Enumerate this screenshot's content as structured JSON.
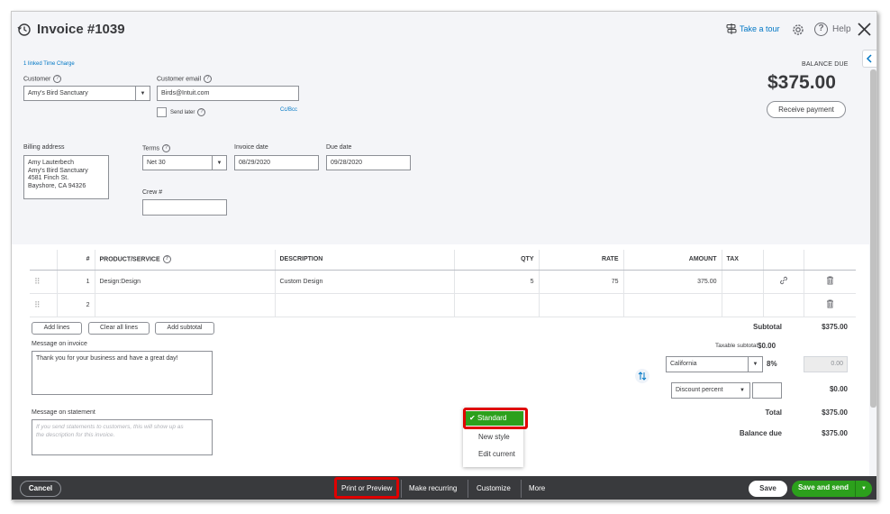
{
  "header": {
    "title": "Invoice #1039",
    "take_tour": "Take a tour",
    "help": "Help"
  },
  "form": {
    "linked_time": "1 linked Time Charge",
    "customer_label": "Customer",
    "customer_value": "Amy's Bird Sanctuary",
    "email_label": "Customer email",
    "email_value": "Birds@Intuit.com",
    "send_later": "Send later",
    "cc_bcc": "Cc/Bcc",
    "balance_label": "BALANCE DUE",
    "balance_amount": "$375.00",
    "receive_payment": "Receive payment",
    "billing_label": "Billing address",
    "billing_lines": [
      "Amy Lauterbech",
      "Amy's Bird Sanctuary",
      "4581 Finch St.",
      "Bayshore, CA  94326"
    ],
    "terms_label": "Terms",
    "terms_value": "Net 30",
    "invoice_date_label": "Invoice date",
    "invoice_date_value": "08/29/2020",
    "due_date_label": "Due date",
    "due_date_value": "09/28/2020",
    "crew_label": "Crew #",
    "crew_value": ""
  },
  "table": {
    "headers": {
      "num": "#",
      "product": "PRODUCT/SERVICE",
      "description": "DESCRIPTION",
      "qty": "QTY",
      "rate": "RATE",
      "amount": "AMOUNT",
      "tax": "TAX"
    },
    "rows": [
      {
        "num": "1",
        "product": "Design:Design",
        "description": "Custom Design",
        "qty": "5",
        "rate": "75",
        "amount": "375.00",
        "tax": ""
      },
      {
        "num": "2",
        "product": "",
        "description": "",
        "qty": "",
        "rate": "",
        "amount": "",
        "tax": ""
      }
    ],
    "add_lines": "Add lines",
    "clear_lines": "Clear all lines",
    "add_subtotal": "Add subtotal"
  },
  "messages": {
    "invoice_label": "Message on invoice",
    "invoice_text": "Thank you for your business and have a great day!",
    "statement_label": "Message on statement",
    "statement_placeholder_1": "If you send statements to customers, this will show up as",
    "statement_placeholder_2": "the description for this invoice."
  },
  "totals": {
    "subtotal_label": "Subtotal",
    "subtotal_value": "$375.00",
    "taxable_label": "Taxable subtotal",
    "taxable_value": "$0.00",
    "tax_region": "California",
    "tax_rate": "8%",
    "tax_amount": "0.00",
    "discount_type": "Discount percent",
    "discount_value": "$0.00",
    "total_label": "Total",
    "total_value": "$375.00",
    "balance_due_label": "Balance due",
    "balance_due_value": "$375.00"
  },
  "style_menu": {
    "options": [
      "Standard",
      "New style",
      "Edit current"
    ]
  },
  "footer": {
    "cancel": "Cancel",
    "print_preview": "Print or Preview",
    "make_recurring": "Make recurring",
    "customize": "Customize",
    "more": "More",
    "save": "Save",
    "save_send": "Save and send"
  },
  "colors": {
    "brand_green": "#2ca01c",
    "link_blue": "#0077c5",
    "footer_dark": "#393a3d",
    "highlight_red": "#e00000"
  }
}
